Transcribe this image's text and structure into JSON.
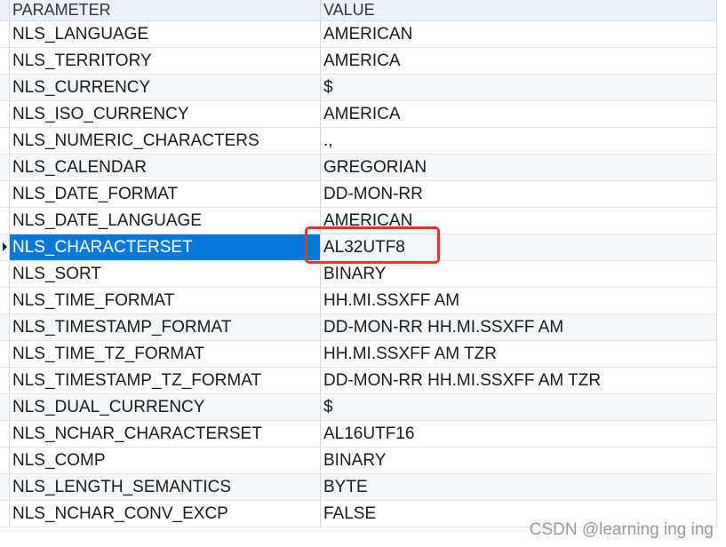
{
  "table": {
    "headers": {
      "param": "PARAMETER",
      "value": "VALUE"
    },
    "rows": [
      {
        "param": "NLS_LANGUAGE",
        "value": "AMERICAN"
      },
      {
        "param": "NLS_TERRITORY",
        "value": "AMERICA"
      },
      {
        "param": "NLS_CURRENCY",
        "value": "$"
      },
      {
        "param": "NLS_ISO_CURRENCY",
        "value": "AMERICA"
      },
      {
        "param": "NLS_NUMERIC_CHARACTERS",
        "value": ".,"
      },
      {
        "param": "NLS_CALENDAR",
        "value": "GREGORIAN"
      },
      {
        "param": "NLS_DATE_FORMAT",
        "value": "DD-MON-RR"
      },
      {
        "param": "NLS_DATE_LANGUAGE",
        "value": "AMERICAN"
      },
      {
        "param": "NLS_CHARACTERSET",
        "value": "AL32UTF8"
      },
      {
        "param": "NLS_SORT",
        "value": "BINARY"
      },
      {
        "param": "NLS_TIME_FORMAT",
        "value": "HH.MI.SSXFF AM"
      },
      {
        "param": "NLS_TIMESTAMP_FORMAT",
        "value": "DD-MON-RR HH.MI.SSXFF AM"
      },
      {
        "param": "NLS_TIME_TZ_FORMAT",
        "value": "HH.MI.SSXFF AM TZR"
      },
      {
        "param": "NLS_TIMESTAMP_TZ_FORMAT",
        "value": "DD-MON-RR HH.MI.SSXFF AM TZR"
      },
      {
        "param": "NLS_DUAL_CURRENCY",
        "value": "$"
      },
      {
        "param": "NLS_NCHAR_CHARACTERSET",
        "value": "AL16UTF16"
      },
      {
        "param": "NLS_COMP",
        "value": "BINARY"
      },
      {
        "param": "NLS_LENGTH_SEMANTICS",
        "value": "BYTE"
      },
      {
        "param": "NLS_NCHAR_CONV_EXCP",
        "value": "FALSE"
      }
    ],
    "selected_row": "NLS_CHARACTERSET",
    "selection_color": "#0a78d7",
    "highlight_color": "#e8342c"
  },
  "watermark": "CSDN @learning ing ing"
}
